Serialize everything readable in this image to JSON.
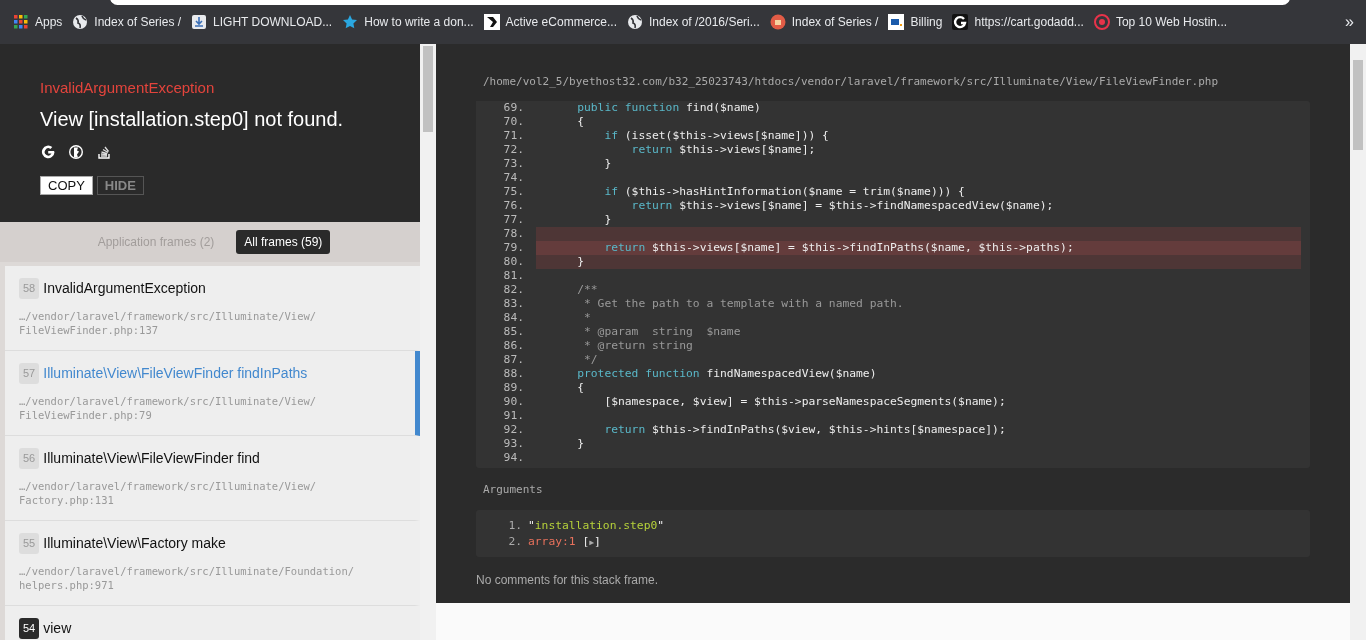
{
  "bookmarks": [
    {
      "kind": "apps",
      "label": "Apps"
    },
    {
      "kind": "globe",
      "label": "Index of Series /"
    },
    {
      "kind": "download",
      "label": "LIGHT DOWNLOAD..."
    },
    {
      "kind": "star",
      "label": "How to write a don..."
    },
    {
      "kind": "logo",
      "label": "Active eCommerce..."
    },
    {
      "kind": "globe",
      "label": "Index of /2016/Seri..."
    },
    {
      "kind": "badge",
      "label": "Index of Series /"
    },
    {
      "kind": "square",
      "label": "Billing"
    },
    {
      "kind": "ring",
      "label": "https://cart.godadd..."
    },
    {
      "kind": "target",
      "label": "Top 10 Web Hostin..."
    }
  ],
  "more": "»",
  "exception": {
    "type": "InvalidArgumentException",
    "message": "View [installation.step0] not found.",
    "buttons": [
      {
        "label": "COPY",
        "disabled": false
      },
      {
        "label": "HIDE",
        "disabled": true
      }
    ]
  },
  "frame_tabs": [
    {
      "label": "Application frames (2)",
      "selected": false
    },
    {
      "label": "All frames (59)",
      "selected": true
    }
  ],
  "frames": [
    {
      "index": "58",
      "title": "InvalidArgumentException",
      "path": "…/vendor/laravel/framework/src/Illuminate/View/",
      "file": "FileViewFinder.php:137",
      "selected": false,
      "application": false
    },
    {
      "index": "57",
      "title": "Illuminate\\View\\FileViewFinder findInPaths",
      "path": "…/vendor/laravel/framework/src/Illuminate/View/",
      "file": "FileViewFinder.php:79",
      "selected": true,
      "application": false
    },
    {
      "index": "56",
      "title": "Illuminate\\View\\FileViewFinder find",
      "path": "…/vendor/laravel/framework/src/Illuminate/View/",
      "file": "Factory.php:131",
      "selected": false,
      "application": false
    },
    {
      "index": "55",
      "title": "Illuminate\\View\\Factory make",
      "path": "…/vendor/laravel/framework/src/Illuminate/Foundation/",
      "file": "helpers.php:971",
      "selected": false,
      "application": false
    },
    {
      "index": "54",
      "title": "view",
      "selected": false,
      "application": true
    }
  ],
  "file_path": "/home/vol2_5/byethost32.com/b32_25023743/htdocs/vendor/laravel/framework/src/Illuminate/View/FileViewFinder.php",
  "code_lines": [
    {
      "number": "69.",
      "highlighted": false,
      "error": false,
      "segments": [
        {
          "kind": "keyword",
          "text": "    public function"
        },
        {
          "kind": "plain",
          "text": " find($name)"
        }
      ]
    },
    {
      "number": "70.",
      "highlighted": false,
      "error": false,
      "segments": [
        {
          "kind": "plain",
          "text": "    {"
        }
      ]
    },
    {
      "number": "71.",
      "highlighted": false,
      "error": false,
      "segments": [
        {
          "kind": "keyword",
          "text": "        if"
        },
        {
          "kind": "plain",
          "text": " (isset($this->views[$name])) {"
        }
      ]
    },
    {
      "number": "72.",
      "highlighted": false,
      "error": false,
      "segments": [
        {
          "kind": "keyword",
          "text": "            return"
        },
        {
          "kind": "plain",
          "text": " $this->views[$name];"
        }
      ]
    },
    {
      "number": "73.",
      "highlighted": false,
      "error": false,
      "segments": [
        {
          "kind": "plain",
          "text": "        }"
        }
      ]
    },
    {
      "number": "74.",
      "highlighted": false,
      "error": false
    },
    {
      "number": "75.",
      "highlighted": false,
      "error": false,
      "segments": [
        {
          "kind": "keyword",
          "text": "        if"
        },
        {
          "kind": "plain",
          "text": " ($this->hasHintInformation($name = trim($name))) {"
        }
      ]
    },
    {
      "number": "76.",
      "highlighted": false,
      "error": false,
      "segments": [
        {
          "kind": "keyword",
          "text": "            return"
        },
        {
          "kind": "plain",
          "text": " $this->views[$name] = $this->findNamespacedView($name);"
        }
      ]
    },
    {
      "number": "77.",
      "highlighted": false,
      "error": false,
      "segments": [
        {
          "kind": "plain",
          "text": "        }"
        }
      ]
    },
    {
      "number": "78.",
      "highlighted": true,
      "error": false
    },
    {
      "number": "79.",
      "highlighted": true,
      "error": true,
      "segments": [
        {
          "kind": "keyword",
          "text": "        return"
        },
        {
          "kind": "plain",
          "text": " $this->views[$name] = $this->findInPaths($name, $this->paths);"
        }
      ]
    },
    {
      "number": "80.",
      "highlighted": true,
      "error": false,
      "segments": [
        {
          "kind": "plain",
          "text": "    }"
        }
      ]
    },
    {
      "number": "81.",
      "highlighted": false,
      "error": false
    },
    {
      "number": "82.",
      "highlighted": false,
      "error": false,
      "segments": [
        {
          "kind": "comment",
          "text": "    /**"
        }
      ]
    },
    {
      "number": "83.",
      "highlighted": false,
      "error": false,
      "segments": [
        {
          "kind": "comment",
          "text": "     * Get the path to a template with a named path."
        }
      ]
    },
    {
      "number": "84.",
      "highlighted": false,
      "error": false,
      "segments": [
        {
          "kind": "comment",
          "text": "     *"
        }
      ]
    },
    {
      "number": "85.",
      "highlighted": false,
      "error": false,
      "segments": [
        {
          "kind": "comment",
          "text": "     * @param  string  $name"
        }
      ]
    },
    {
      "number": "86.",
      "highlighted": false,
      "error": false,
      "segments": [
        {
          "kind": "comment",
          "text": "     * @return string"
        }
      ]
    },
    {
      "number": "87.",
      "highlighted": false,
      "error": false,
      "segments": [
        {
          "kind": "comment",
          "text": "     */"
        }
      ]
    },
    {
      "number": "88.",
      "highlighted": false,
      "error": false,
      "segments": [
        {
          "kind": "keyword",
          "text": "    protected function"
        },
        {
          "kind": "plain",
          "text": " findNamespacedView($name)"
        }
      ]
    },
    {
      "number": "89.",
      "highlighted": false,
      "error": false,
      "segments": [
        {
          "kind": "plain",
          "text": "    {"
        }
      ]
    },
    {
      "number": "90.",
      "highlighted": false,
      "error": false,
      "segments": [
        {
          "kind": "plain",
          "text": "        [$namespace, $view] = $this->parseNamespaceSegments($name);"
        }
      ]
    },
    {
      "number": "91.",
      "highlighted": false,
      "error": false
    },
    {
      "number": "92.",
      "highlighted": false,
      "error": false,
      "segments": [
        {
          "kind": "keyword",
          "text": "        return"
        },
        {
          "kind": "plain",
          "text": " $this->findInPaths($view, $this->hints[$namespace]);"
        }
      ]
    },
    {
      "number": "93.",
      "highlighted": false,
      "error": false,
      "segments": [
        {
          "kind": "plain",
          "text": "    }"
        }
      ]
    },
    {
      "number": "94.",
      "highlighted": false,
      "error": false
    }
  ],
  "arguments": {
    "title": "Arguments",
    "items": [
      {
        "number": "1.",
        "segments": [
          {
            "kind": "punct",
            "text": "\""
          },
          {
            "kind": "string",
            "text": "installation.step0"
          },
          {
            "kind": "punct",
            "text": "\""
          }
        ]
      },
      {
        "number": "2.",
        "segments": [
          {
            "kind": "type",
            "text": "array:1"
          },
          {
            "kind": "punct",
            "text": " ["
          },
          {
            "kind": "toggle",
            "text": "▶"
          },
          {
            "kind": "punct",
            "text": "]"
          }
        ]
      }
    ]
  },
  "comments_note": "No comments for this stack frame."
}
